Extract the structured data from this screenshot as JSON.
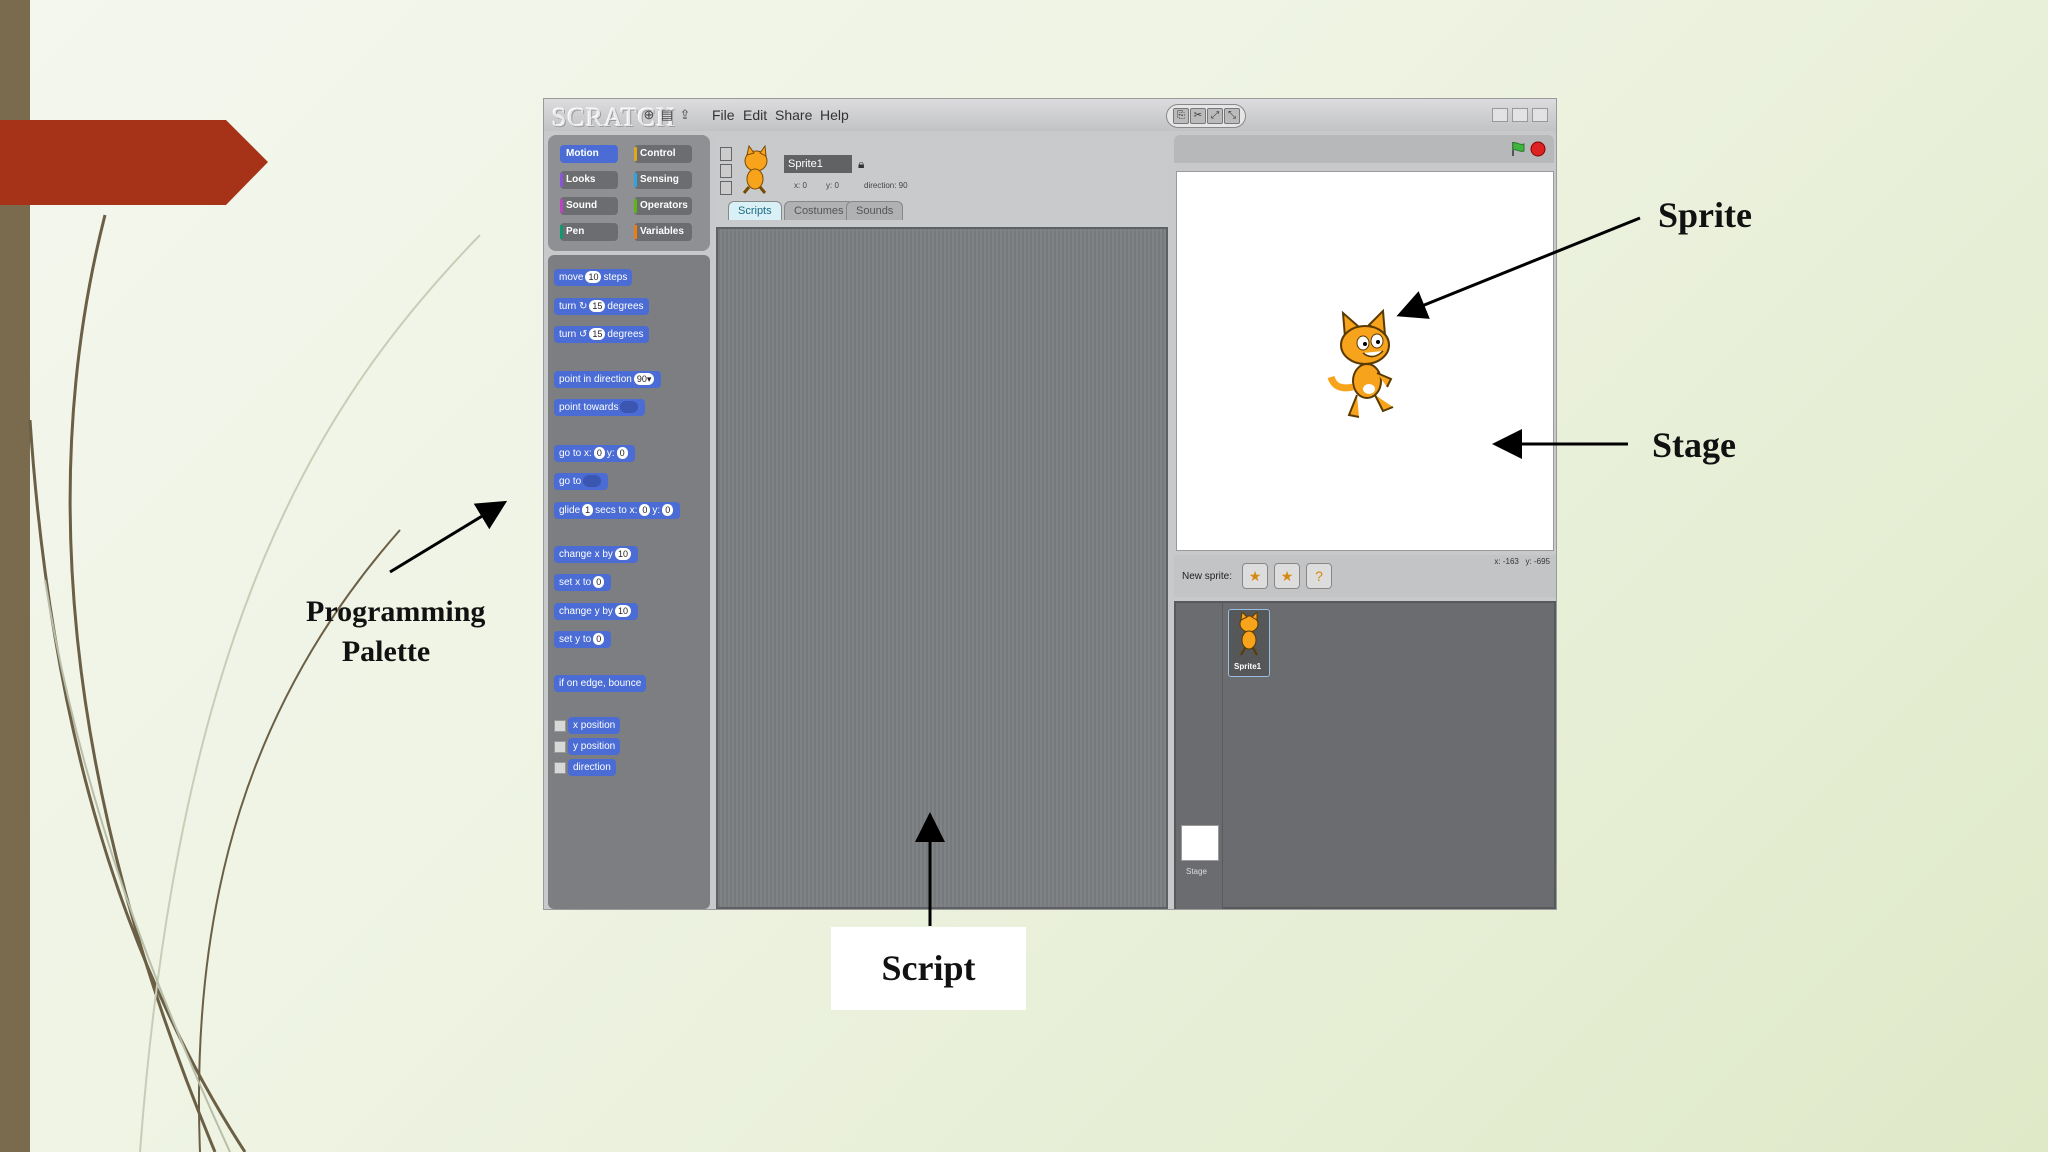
{
  "slide": {
    "labels": {
      "sprite": "Sprite",
      "stage": "Stage",
      "palette_line1": "Programming",
      "palette_line2": "Palette",
      "script": "Script"
    },
    "colors": {
      "accent_tab": "#a63218",
      "side_bar": "#7a6a4e"
    }
  },
  "scratch": {
    "logo": "SCRATCH",
    "menu": [
      "File",
      "Edit",
      "Share",
      "Help"
    ],
    "categories": [
      {
        "label": "Motion",
        "color": "#4a6cd4"
      },
      {
        "label": "Control",
        "color": "#e1a91a"
      },
      {
        "label": "Looks",
        "color": "#8a55d7"
      },
      {
        "label": "Sensing",
        "color": "#2ca5e2"
      },
      {
        "label": "Sound",
        "color": "#bb42c3"
      },
      {
        "label": "Operators",
        "color": "#5cb712"
      },
      {
        "label": "Pen",
        "color": "#0e9a6c"
      },
      {
        "label": "Variables",
        "color": "#ee7d16"
      }
    ],
    "blocks": {
      "move": [
        "move",
        "10",
        "steps"
      ],
      "turn_right": [
        "turn ↻",
        "15",
        "degrees"
      ],
      "turn_left": [
        "turn ↺",
        "15",
        "degrees"
      ],
      "point_direction": [
        "point in direction",
        "90▾"
      ],
      "point_towards": [
        "point towards"
      ],
      "go_to_xy": [
        "go to x:",
        "0",
        "y:",
        "0"
      ],
      "go_to": [
        "go to"
      ],
      "glide": [
        "glide",
        "1",
        "secs to x:",
        "0",
        "y:",
        "0"
      ],
      "change_x": [
        "change x by",
        "10"
      ],
      "set_x": [
        "set x to",
        "0"
      ],
      "change_y": [
        "change y by",
        "10"
      ],
      "set_y": [
        "set y to",
        "0"
      ],
      "bounce": [
        "if on edge, bounce"
      ],
      "reporters": [
        "x position",
        "y position",
        "direction"
      ]
    },
    "sprite_info": {
      "name": "Sprite1",
      "x_label": "x: 0",
      "y_label": "y: 0",
      "direction_label": "direction: 90"
    },
    "tabs": [
      "Scripts",
      "Costumes",
      "Sounds"
    ],
    "status": {
      "new_sprite_label": "New sprite:",
      "mouse_x": "x: -163",
      "mouse_y": "y: -695"
    },
    "sprite_list": {
      "sprite_thumb_label": "Sprite1",
      "stage_thumb_label": "Stage"
    }
  }
}
